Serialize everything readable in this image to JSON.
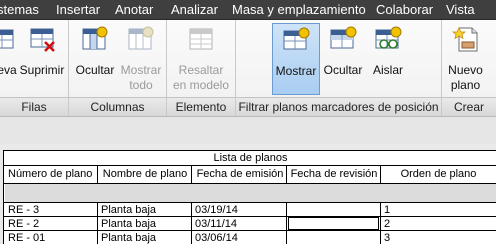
{
  "menubar": {
    "items": [
      "stemas",
      "Insertar",
      "Anotar",
      "Analizar",
      "Masa y emplazamiento",
      "Colaborar",
      "Vista"
    ]
  },
  "ribbon": {
    "groups": {
      "filas": {
        "label": "Filas",
        "buttons": [
          "eva",
          "Suprimir"
        ]
      },
      "columnas": {
        "label": "Columnas",
        "buttons": [
          "Ocultar",
          "Mostrar\ntodo"
        ]
      },
      "elemento": {
        "label": "Elemento",
        "buttons": [
          "Resaltar\nen modelo"
        ]
      },
      "filtrar": {
        "label": "Filtrar planos marcadores de posición",
        "buttons": [
          "Mostrar",
          "Ocultar",
          "Aislar"
        ]
      },
      "crear": {
        "label": "Crear",
        "buttons": [
          "Nuevo\nplano"
        ]
      }
    }
  },
  "schedule": {
    "title": "Lista de planos",
    "headers": [
      "Número de plano",
      "Nombre de plano",
      "Fecha de emisión",
      "Fecha de revisión",
      "Orden de plano"
    ],
    "rows": [
      [
        "RE - 3",
        "Planta baja",
        "03/19/14",
        "",
        "1"
      ],
      [
        "RE - 2",
        "Planta baja",
        "03/11/14",
        "",
        "2"
      ],
      [
        "RE - 01",
        "Planta baja",
        "03/06/14",
        "",
        "3"
      ]
    ]
  }
}
